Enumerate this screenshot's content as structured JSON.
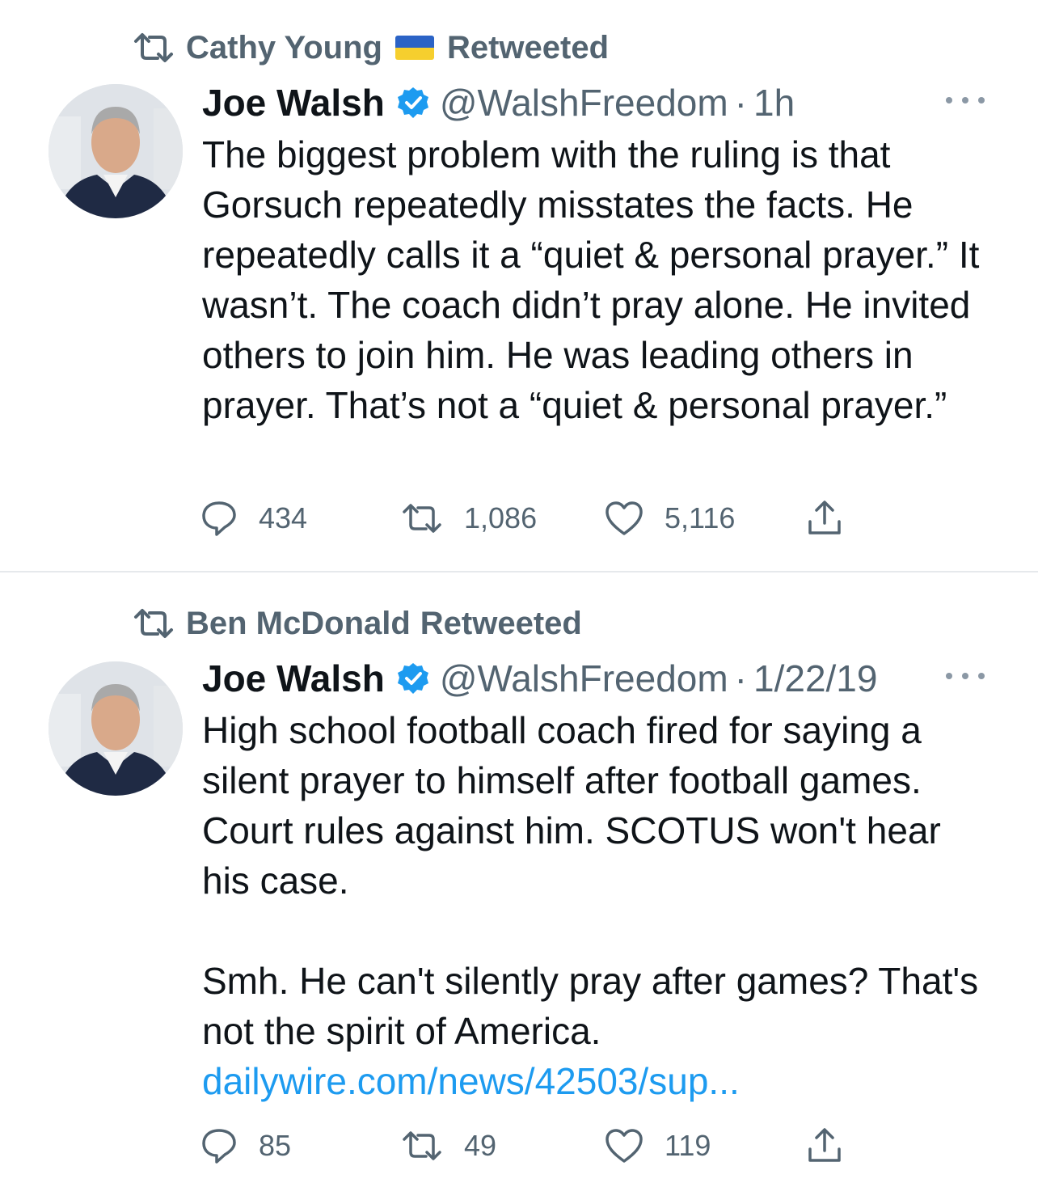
{
  "tweets": [
    {
      "retweeted_by": "Cathy Young",
      "retweeted_by_flag": "ukraine-flag",
      "retweeted_label": "Retweeted",
      "author_name": "Joe Walsh",
      "handle": "@WalshFreedom",
      "separator": "·",
      "time": "1h",
      "text": "The biggest problem with the ruling is that Gorsuch repeatedly misstates the facts. He repeatedly calls it a “quiet & personal prayer.” It wasn’t. The coach didn’t pray alone. He invited others to join him. He was leading others in prayer. That’s not a “quiet & personal prayer.”",
      "link": "",
      "replies": "434",
      "retweets": "1,086",
      "likes": "5,116"
    },
    {
      "retweeted_by": "Ben McDonald",
      "retweeted_label": "Retweeted",
      "author_name": "Joe Walsh",
      "handle": "@WalshFreedom",
      "separator": "·",
      "time": "1/22/19",
      "text": "High school football coach fired for saying a silent prayer to himself after football games. Court rules against him. SCOTUS won't hear his case.\n\nSmh. He can't silently pray after games? That's not the spirit of America.",
      "link": "dailywire.com/news/42503/sup...",
      "replies": "85",
      "retweets": "49",
      "likes": "119"
    }
  ],
  "colors": {
    "secondary_text": "#536471",
    "link": "#1d9bf0",
    "verified_badge": "#1d9bf0",
    "divider": "#e6e9ec"
  }
}
